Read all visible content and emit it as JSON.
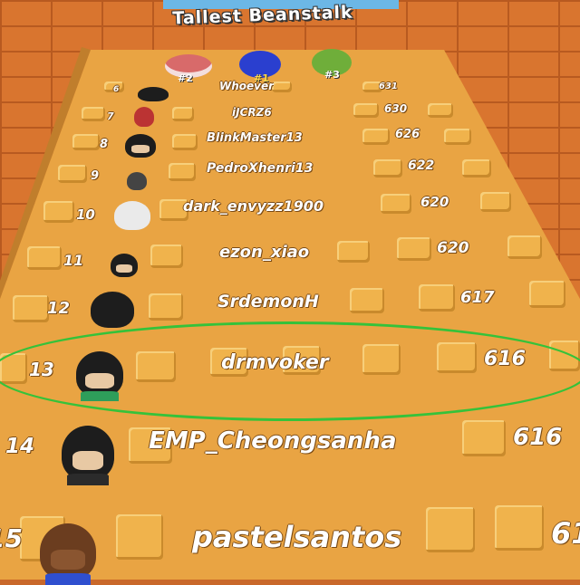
{
  "board": {
    "title": "Tallest Beanstalk",
    "top3": [
      {
        "label": "#2",
        "icon": "avatar-mushroom-icon"
      },
      {
        "label": "#1",
        "icon": "avatar-blue-icon"
      },
      {
        "label": "#3",
        "icon": "avatar-green-icon"
      }
    ],
    "rows": [
      {
        "rank": "6",
        "name": "Whoever",
        "score": "631"
      },
      {
        "rank": "7",
        "name": "iJCRZ6",
        "score": "630"
      },
      {
        "rank": "8",
        "name": "BlinkMaster13",
        "score": "626"
      },
      {
        "rank": "9",
        "name": "PedroXhenri13",
        "score": "622"
      },
      {
        "rank": "10",
        "name": "dark_envyzz1900",
        "score": "620"
      },
      {
        "rank": "11",
        "name": "ezon_xiao",
        "score": "620"
      },
      {
        "rank": "12",
        "name": "SrdemonH",
        "score": "617"
      },
      {
        "rank": "13",
        "name": "drmvoker",
        "score": "616"
      },
      {
        "rank": "14",
        "name": "EMP_Cheongsanha",
        "score": "616"
      },
      {
        "rank": "15",
        "name": "pastelsantos",
        "score": "61"
      }
    ]
  },
  "colors": {
    "board": "#e9a443",
    "tile": "#f0b34c",
    "wall": "#d9752f",
    "highlight": "#35c23a"
  }
}
